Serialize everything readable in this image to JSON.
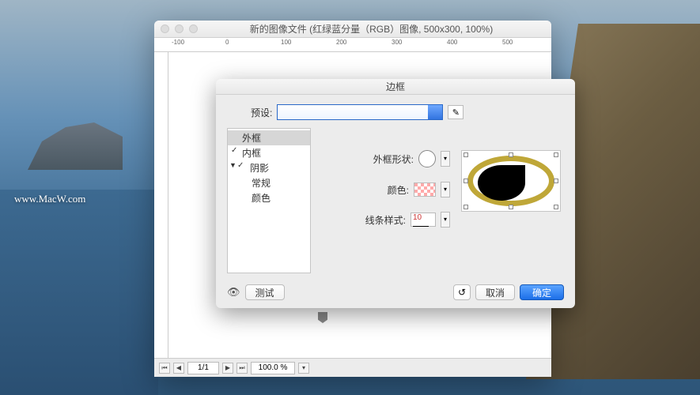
{
  "watermark": "www.MacW.com",
  "window": {
    "title": "新的图像文件 (红绿蓝分量（RGB）图像, 500x300, 100%)"
  },
  "ruler": {
    "marks": [
      "-100",
      "0",
      "100",
      "200",
      "300",
      "400",
      "500"
    ]
  },
  "statusbar": {
    "page": "1/1",
    "zoom": "100.0 %"
  },
  "dialog": {
    "title": "边框",
    "preset_label": "预设:",
    "sections": {
      "outer": "外框",
      "inner": "内框",
      "shadow": "阴影",
      "general": "常规",
      "color": "颜色"
    },
    "fields": {
      "shape_label": "外框形状:",
      "color_label": "颜色:",
      "stroke_label": "线条样式:",
      "stroke_value": "10"
    },
    "buttons": {
      "test": "测试",
      "cancel": "取消",
      "ok": "确定"
    }
  }
}
